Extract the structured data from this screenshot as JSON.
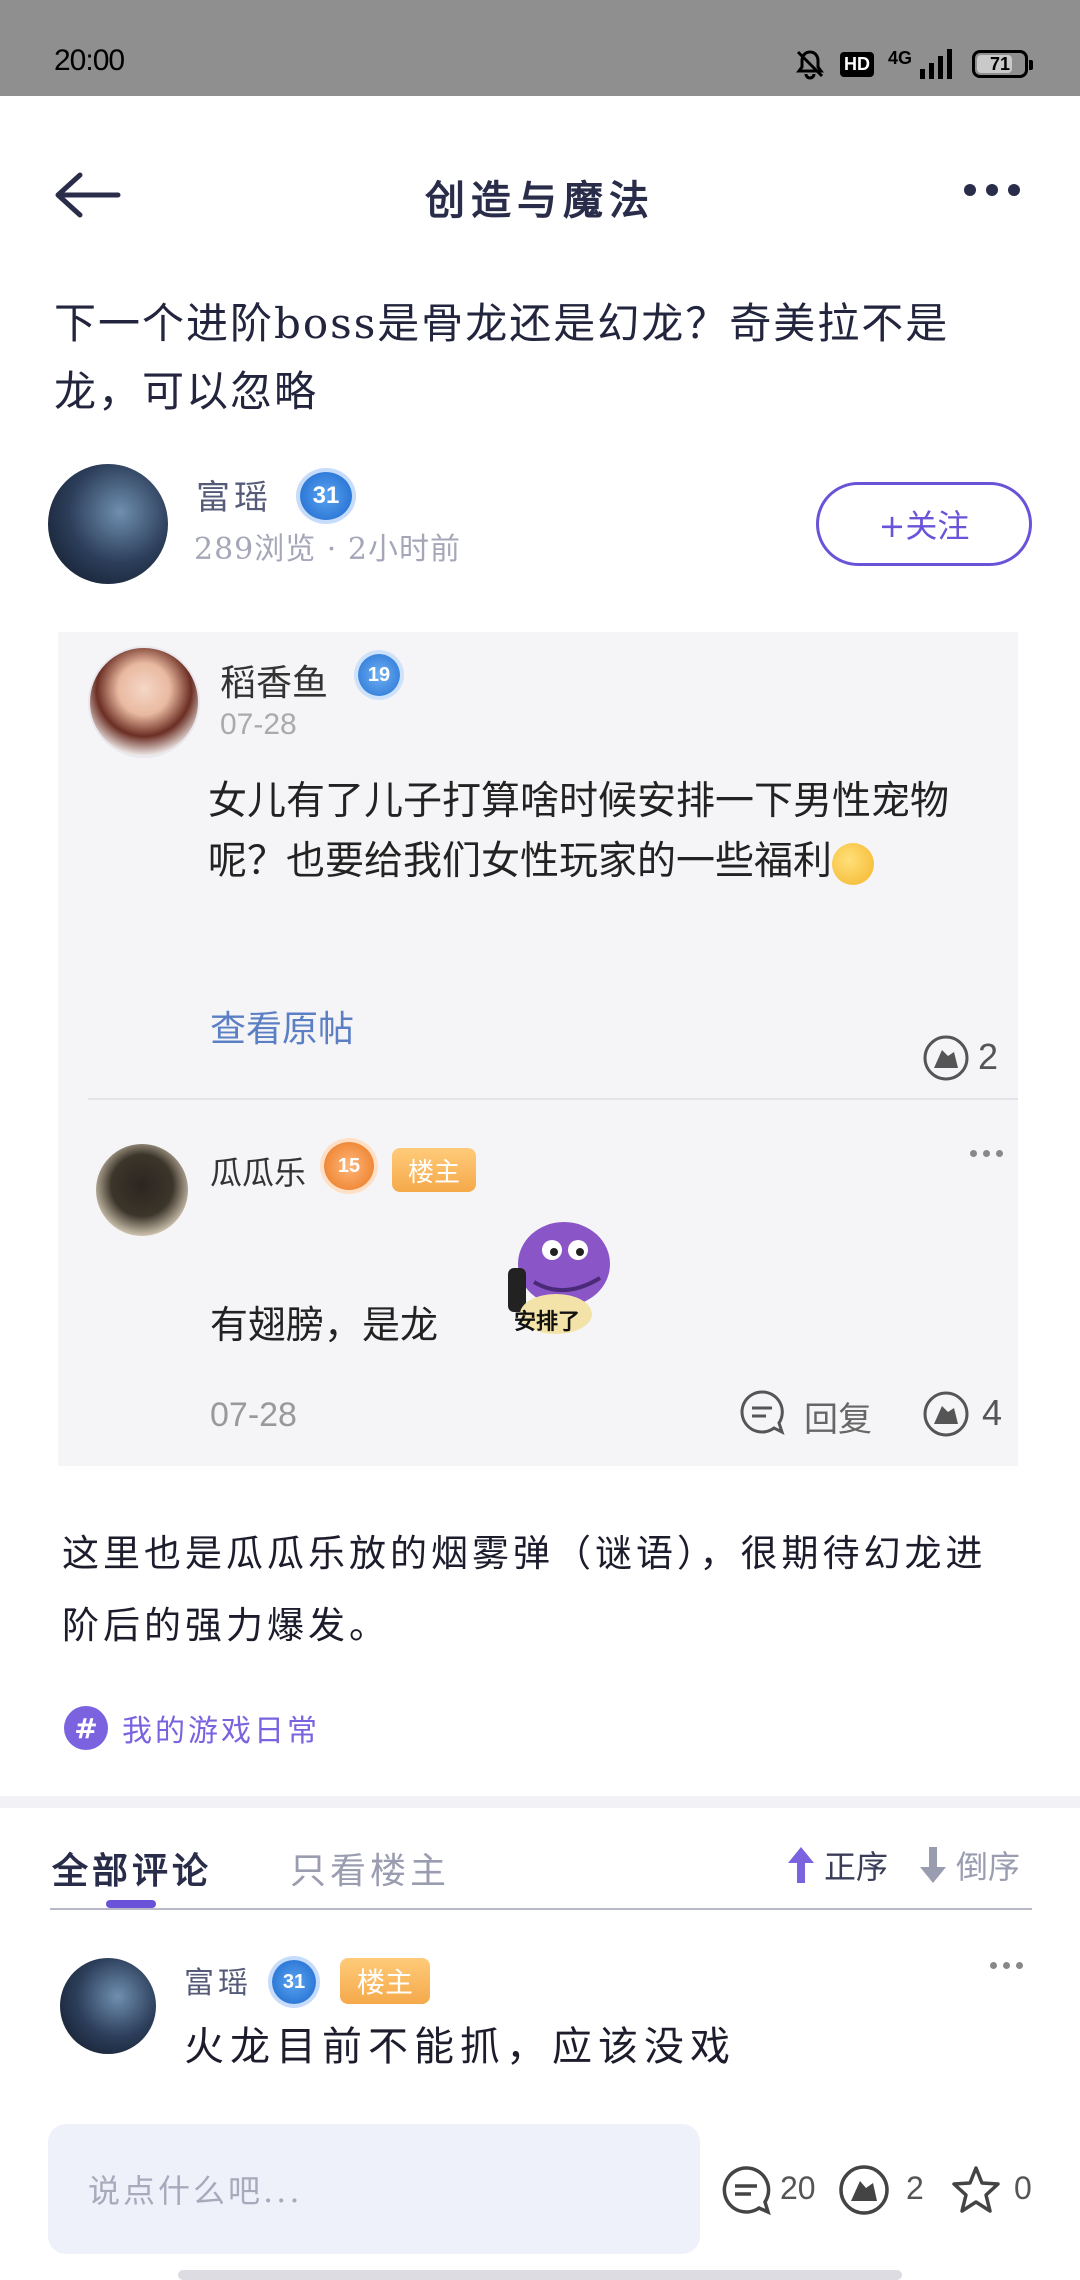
{
  "status_bar": {
    "time": "20:00",
    "network": "4G",
    "hd": "HD",
    "battery": "71"
  },
  "header": {
    "title": "创造与魔法"
  },
  "post": {
    "title": "下一个进阶boss是骨龙还是幻龙？奇美拉不是龙，可以忽略",
    "author": {
      "name": "富瑶",
      "level": "31",
      "meta": "289浏览 · 2小时前"
    },
    "follow_label": "+关注",
    "body": "这里也是瓜瓜乐放的烟雾弹（谜语），很期待幻龙进阶后的强力爆发。",
    "topic": "我的游戏日常"
  },
  "embedded": {
    "post": {
      "name": "稻香鱼",
      "level": "19",
      "date": "07-28",
      "text": "女儿有了儿子打算啥时候安排一下男性宠物呢？也要给我们女性玩家的一些福利",
      "view_original": "查看原帖",
      "likes": "2"
    },
    "reply": {
      "name": "瓜瓜乐",
      "level": "15",
      "tag": "楼主",
      "text": "有翅膀，是龙",
      "sticker_text": "安排了",
      "date": "07-28",
      "reply_label": "回复",
      "likes": "4"
    }
  },
  "comments_tabs": {
    "all": "全部评论",
    "owner_only": "只看楼主",
    "sort_asc": "正序",
    "sort_desc": "倒序"
  },
  "comment": {
    "name": "富瑶",
    "level": "31",
    "tag": "楼主",
    "text": "火龙目前不能抓，应该没戏"
  },
  "bottom_bar": {
    "placeholder": "说点什么吧...",
    "comments": "20",
    "likes": "2",
    "favorites": "0"
  },
  "colors": {
    "accent": "#6a52d9",
    "owner_tag": "#f5a94a",
    "level_blue": "#2f7ad8"
  }
}
